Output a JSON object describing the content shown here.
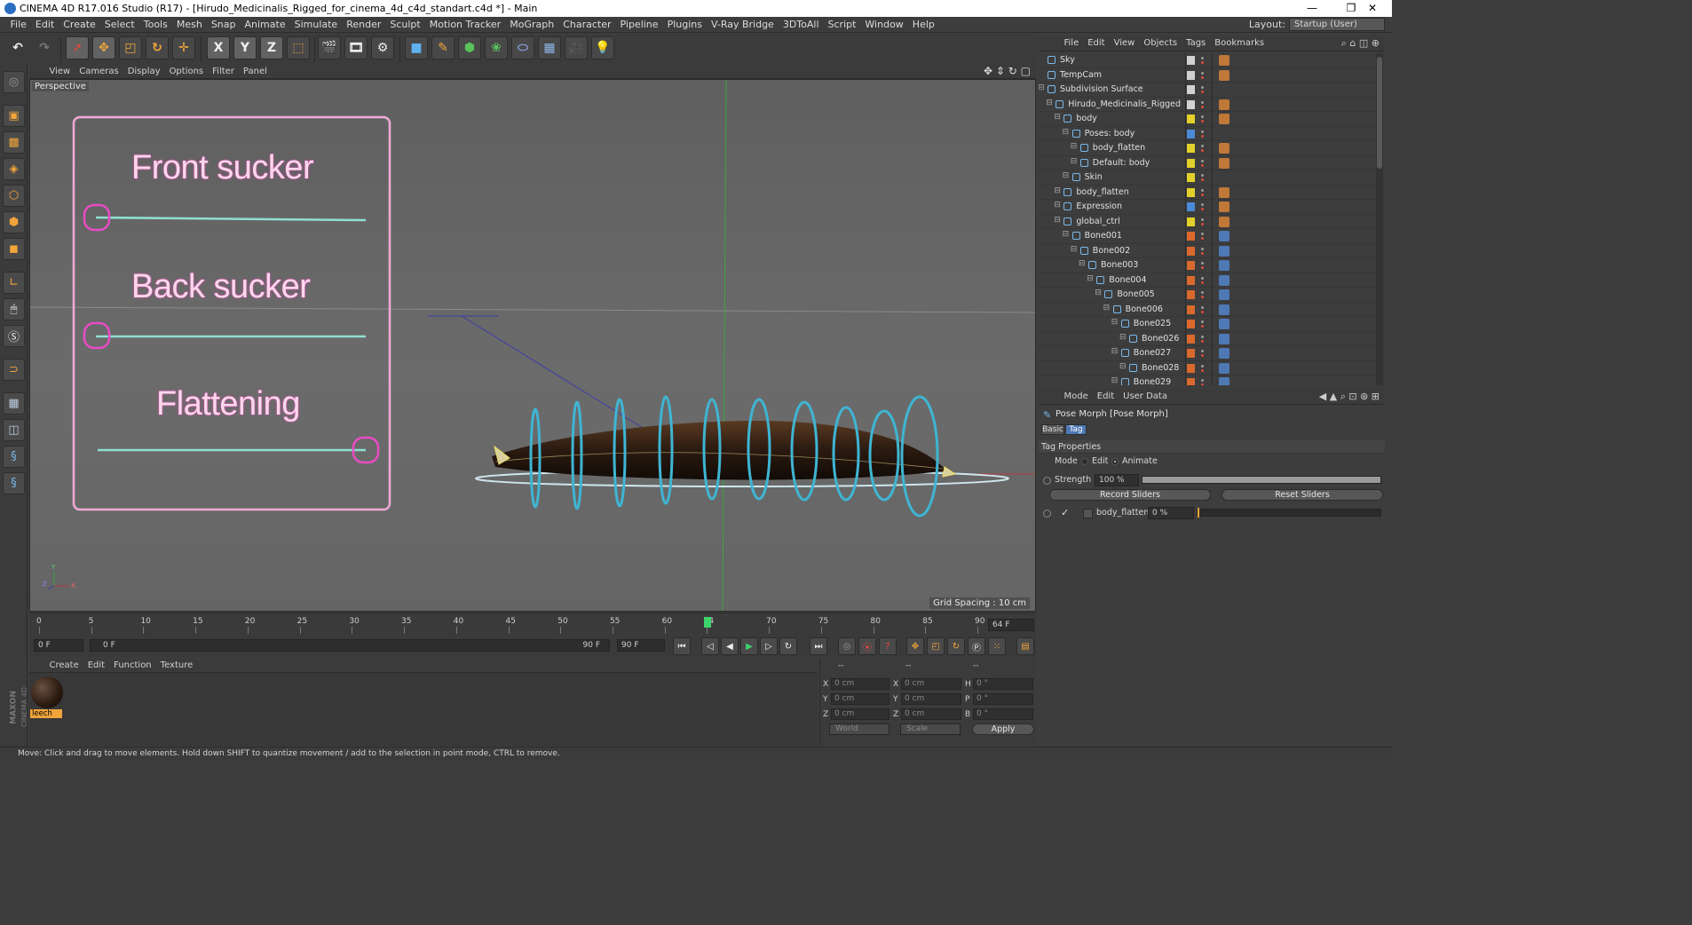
{
  "window": {
    "title": "CINEMA 4D R17.016 Studio (R17) - [Hirudo_Medicinalis_Rigged_for_cinema_4d_c4d_standart.c4d *] - Main",
    "minimize": "—",
    "restore": "❐",
    "close": "✕"
  },
  "menubar": {
    "items": [
      "File",
      "Edit",
      "Create",
      "Select",
      "Tools",
      "Mesh",
      "Snap",
      "Animate",
      "Simulate",
      "Render",
      "Sculpt",
      "Motion Tracker",
      "MoGraph",
      "Character",
      "Pipeline",
      "Plugins",
      "V-Ray Bridge",
      "3DToAll",
      "Script",
      "Window",
      "Help"
    ],
    "layout_label": "Layout:",
    "layout_value": "Startup (User)"
  },
  "toolbar": {
    "x_label": "X",
    "y_label": "Y",
    "z_label": "Z"
  },
  "viewport": {
    "menu": [
      "View",
      "Cameras",
      "Display",
      "Options",
      "Filter",
      "Panel"
    ],
    "label": "Perspective",
    "grid_spacing": "Grid Spacing : 10 cm",
    "controls": {
      "front_sucker": "Front sucker",
      "back_sucker": "Back sucker",
      "flattening": "Flattening"
    },
    "axis_y": "Y",
    "axis_z": "Z",
    "axis_x": "X"
  },
  "timeline": {
    "ticks": [
      "0",
      "5",
      "10",
      "15",
      "20",
      "25",
      "30",
      "35",
      "40",
      "45",
      "50",
      "55",
      "60",
      "64",
      "70",
      "75",
      "80",
      "85",
      "90"
    ],
    "current_frame": "64 F",
    "start_field": "0 F",
    "range_start": "0 F",
    "range_end": "90 F",
    "end_field": "90 F"
  },
  "material_manager": {
    "menu": [
      "Create",
      "Edit",
      "Function",
      "Texture"
    ],
    "material_name": "leech",
    "brand_top": "MAXON",
    "brand_bottom": "CINEMA 4D"
  },
  "coordinates": {
    "header": [
      "--",
      "--",
      "--"
    ],
    "rows": [
      {
        "a": "X",
        "av": "0 cm",
        "b": "X",
        "bv": "0 cm",
        "c": "H",
        "cv": "0 °"
      },
      {
        "a": "Y",
        "av": "0 cm",
        "b": "Y",
        "bv": "0 cm",
        "c": "P",
        "cv": "0 °"
      },
      {
        "a": "Z",
        "av": "0 cm",
        "b": "Z",
        "bv": "0 cm",
        "c": "B",
        "cv": "0 °"
      }
    ],
    "mode_world": "World",
    "mode_scale": "Scale",
    "apply": "Apply"
  },
  "status": {
    "text": "Move: Click and drag to move elements. Hold down SHIFT to quantize movement / add to the selection in point mode, CTRL to remove."
  },
  "object_manager": {
    "menu": [
      "File",
      "Edit",
      "View",
      "Objects",
      "Tags",
      "Bookmarks"
    ],
    "objects": [
      {
        "name": "Sky",
        "indent": 0,
        "color": "#d0d0d0"
      },
      {
        "name": "TempCam",
        "indent": 0,
        "color": "#d0d0d0"
      },
      {
        "name": "Subdivision Surface",
        "indent": 0,
        "color": "#d0d0d0"
      },
      {
        "name": "Hirudo_Medicinalis_Rigged",
        "indent": 1,
        "color": "#d0d0d0"
      },
      {
        "name": "body",
        "indent": 2,
        "color": "#e2d12a"
      },
      {
        "name": "Poses: body",
        "indent": 3,
        "color": "#4a8ad6"
      },
      {
        "name": "body_flatten",
        "indent": 4,
        "color": "#e2d12a"
      },
      {
        "name": "Default: body",
        "indent": 4,
        "color": "#e2d12a"
      },
      {
        "name": "Skin",
        "indent": 3,
        "color": "#e2d12a"
      },
      {
        "name": "body_flatten",
        "indent": 2,
        "color": "#e2d12a"
      },
      {
        "name": "Expression",
        "indent": 2,
        "color": "#4a8ad6"
      },
      {
        "name": "global_ctrl",
        "indent": 2,
        "color": "#e2d12a"
      },
      {
        "name": "Bone001",
        "indent": 3,
        "color": "#d9692c"
      },
      {
        "name": "Bone002",
        "indent": 4,
        "color": "#d9692c"
      },
      {
        "name": "Bone003",
        "indent": 5,
        "color": "#d9692c"
      },
      {
        "name": "Bone004",
        "indent": 6,
        "color": "#d9692c"
      },
      {
        "name": "Bone005",
        "indent": 7,
        "color": "#d9692c"
      },
      {
        "name": "Bone006",
        "indent": 8,
        "color": "#d9692c"
      },
      {
        "name": "Bone025",
        "indent": 9,
        "color": "#d9692c"
      },
      {
        "name": "Bone026",
        "indent": 10,
        "color": "#d9692c"
      },
      {
        "name": "Bone027",
        "indent": 9,
        "color": "#d9692c"
      },
      {
        "name": "Bone028",
        "indent": 10,
        "color": "#d9692c"
      },
      {
        "name": "Bone029",
        "indent": 9,
        "color": "#d9692c"
      }
    ]
  },
  "attribute_manager": {
    "menu": [
      "Mode",
      "Edit",
      "User Data"
    ],
    "object_title": "Pose Morph [Pose Morph]",
    "tabs": [
      "Basic",
      "Tag"
    ],
    "section": "Tag Properties",
    "mode_label": "Mode",
    "mode_edit": "Edit",
    "mode_animate": "Animate",
    "strength_label": "Strength",
    "strength_value": "100 %",
    "strength_fraction": 1.0,
    "record_sliders": "Record Sliders",
    "reset_sliders": "Reset Sliders",
    "morph_name": "body_flatten",
    "morph_value": "0 %",
    "morph_fraction": 0.0
  }
}
